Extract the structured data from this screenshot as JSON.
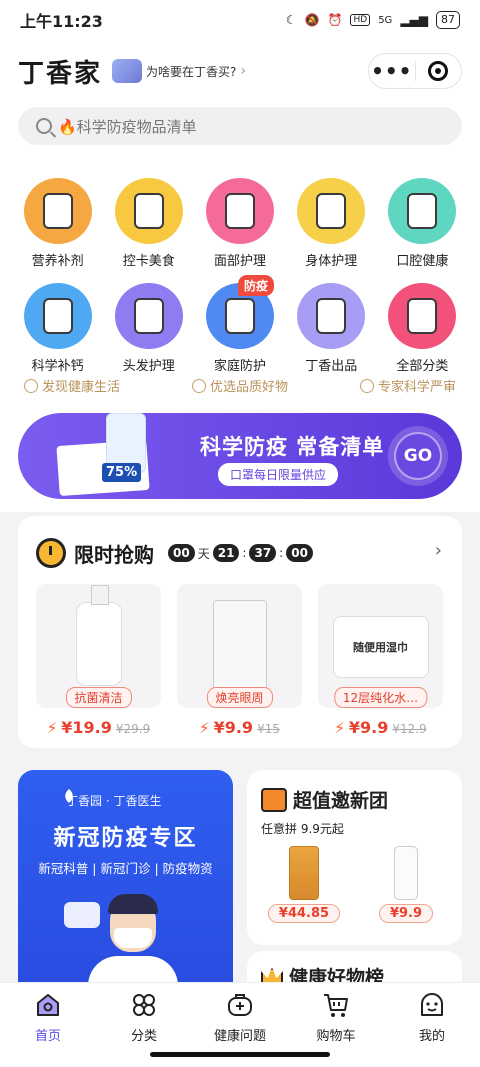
{
  "status_bar": {
    "time": "上午11:23",
    "network": "5G",
    "hd": "HD",
    "battery": "87"
  },
  "header": {
    "brand": "丁香家",
    "why_text": "为啥要在丁香买?",
    "menu_dots": "•••"
  },
  "search": {
    "placeholder": "🔥科学防疫物品清单"
  },
  "categories": [
    {
      "label": "营养补剂",
      "color": "#f5a742"
    },
    {
      "label": "控卡美食",
      "color": "#f7c840"
    },
    {
      "label": "面部护理",
      "color": "#f46a9a"
    },
    {
      "label": "身体护理",
      "color": "#f7d04a"
    },
    {
      "label": "口腔健康",
      "color": "#5fd6bf"
    },
    {
      "label": "科学补钙",
      "color": "#4fa9f2"
    },
    {
      "label": "头发护理",
      "color": "#8e7cf0"
    },
    {
      "label": "家庭防护",
      "color": "#4f8af2",
      "badge": "防疫"
    },
    {
      "label": "丁香出品",
      "color": "#a89df5"
    },
    {
      "label": "全部分类",
      "color": "#f2527a"
    }
  ],
  "features": [
    {
      "label": "发现健康生活"
    },
    {
      "label": "优选品质好物"
    },
    {
      "label": "专家科学严审"
    }
  ],
  "banner": {
    "title": "科学防疫 常备清单",
    "subtitle": "口罩每日限量供应",
    "go": "GO",
    "product_tag": "75%"
  },
  "flash_sale": {
    "title": "限时抢购",
    "timer": [
      "00",
      "21",
      "37",
      "00"
    ],
    "day_unit": "天",
    "items": [
      {
        "tag": "抗菌清洁",
        "price": "¥19.9",
        "original": "¥29.9"
      },
      {
        "tag": "焕亮眼周",
        "price": "¥9.9",
        "original": "¥15"
      },
      {
        "tag": "12层纯化水…",
        "price": "¥9.9",
        "original": "¥12.9",
        "pack_text": "随便用湿巾"
      }
    ]
  },
  "promo": {
    "org": "丁香园 · 丁香医生",
    "title": "新冠防疫专区",
    "subtitle": "新冠科普 | 新冠门诊 | 防疫物资"
  },
  "group_buy": {
    "title": "超值邀新团",
    "subtitle": "任意拼 9.9元起",
    "prices": [
      "¥44.85",
      "¥9.9"
    ]
  },
  "ranking": {
    "title": "健康好物榜"
  },
  "tabbar": [
    {
      "label": "首页",
      "active": true
    },
    {
      "label": "分类"
    },
    {
      "label": "健康问题"
    },
    {
      "label": "购物车"
    },
    {
      "label": "我的"
    }
  ],
  "colors": {
    "accent": "#5b4de3",
    "price": "#e8402c",
    "banner": "#6a44dc",
    "feature_gold": "#b8935a"
  }
}
